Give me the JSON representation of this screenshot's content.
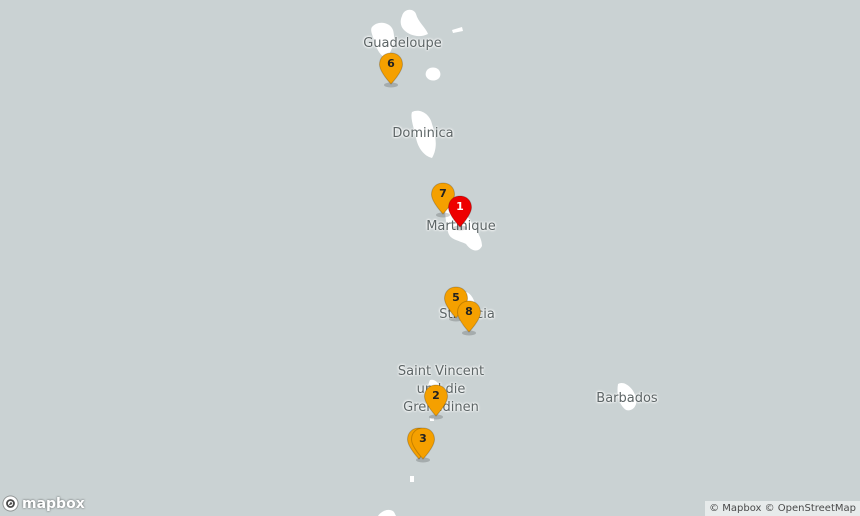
{
  "map": {
    "background_color": "#cad2d3",
    "land_color": "#ffffff",
    "labels": {
      "guadeloupe": "Guadeloupe",
      "dominica": "Dominica",
      "martinique": "Martinique",
      "saint_lucia": "St. Lucia",
      "saint_vincent_line1": "Saint Vincent",
      "saint_vincent_line2": "und die",
      "saint_vincent_line3": "Grenadinen",
      "barbados": "Barbados"
    },
    "markers": [
      {
        "label": "1",
        "color": "#ee0000",
        "selected": true
      },
      {
        "label": "2",
        "color": "#f5a000"
      },
      {
        "label": "3",
        "color": "#f5a000"
      },
      {
        "label": "5",
        "color": "#f5a000"
      },
      {
        "label": "6",
        "color": "#f5a000"
      },
      {
        "label": "7",
        "color": "#f5a000"
      },
      {
        "label": "8",
        "color": "#f5a000"
      }
    ]
  },
  "branding": {
    "logo_text": "mapbox",
    "attribution_mapbox": "© Mapbox",
    "attribution_osm": "© OpenStreetMap"
  }
}
